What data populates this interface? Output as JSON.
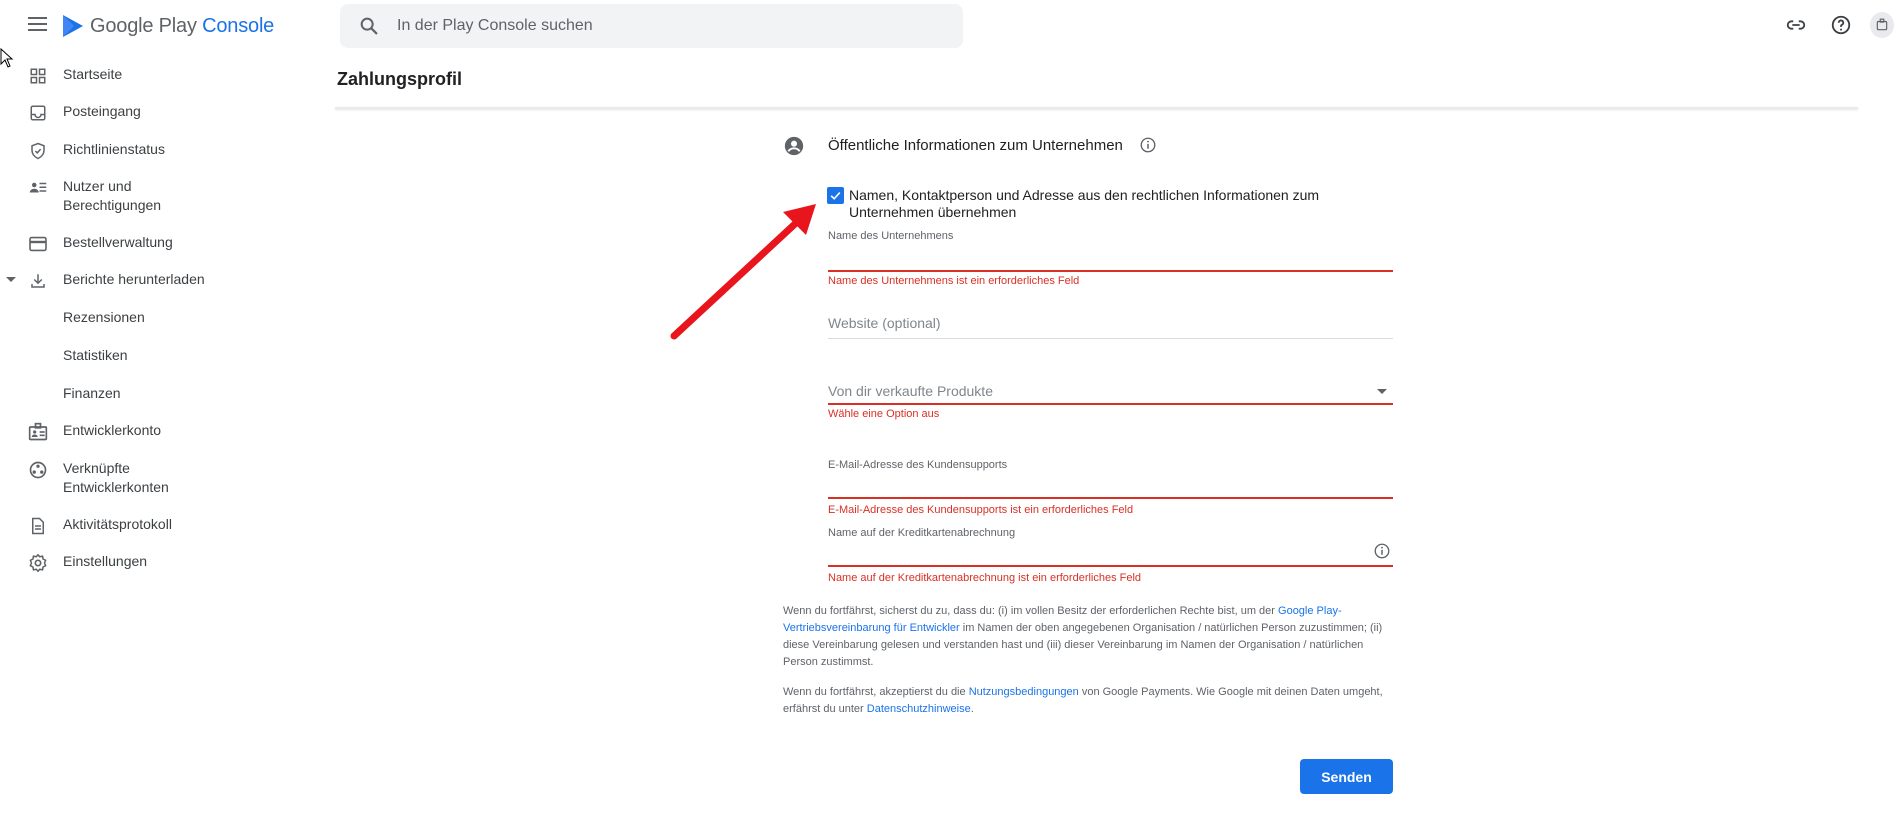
{
  "app": {
    "logo_text_1": "Google Play ",
    "logo_text_2": "Console",
    "search_placeholder": "In der Play Console suchen",
    "brand_color": "#1a73e8"
  },
  "sidebar": {
    "items": [
      {
        "label": "Startseite",
        "icon": "dashboard-icon"
      },
      {
        "label": "Posteingang",
        "icon": "inbox-icon"
      },
      {
        "label": "Richtlinienstatus",
        "icon": "shield-icon"
      },
      {
        "label": "Nutzer und Berechtigungen",
        "icon": "users-list-icon"
      },
      {
        "label": "Bestellverwaltung",
        "icon": "credit-card-icon"
      },
      {
        "label": "Berichte herunterladen",
        "icon": "download-icon",
        "expanded": true
      },
      {
        "label": "Rezensionen"
      },
      {
        "label": "Statistiken"
      },
      {
        "label": "Finanzen"
      },
      {
        "label": "Entwicklerkonto",
        "icon": "badge-icon"
      },
      {
        "label": "Verknüpfte Entwicklerkonten",
        "icon": "linked-accounts-icon"
      },
      {
        "label": "Aktivitätsprotokoll",
        "icon": "document-icon"
      },
      {
        "label": "Einstellungen",
        "icon": "gear-icon"
      }
    ]
  },
  "main": {
    "page_title": "Zahlungsprofil",
    "section_title": "Öffentliche Informationen zum Unternehmen",
    "checkbox_label": "Namen, Kontaktperson und Adresse aus den rechtlichen Informationen zum Unternehmen übernehmen",
    "checkbox_checked": true,
    "fields": {
      "company_name_label": "Name des Unternehmens",
      "company_name_error": "Name des Unternehmens ist ein erforderliches Feld",
      "website_placeholder": "Website (optional)",
      "products_placeholder": "Von dir verkaufte Produkte",
      "products_error": "Wähle eine Option aus",
      "support_email_label": "E-Mail-Adresse des Kundensupports",
      "support_email_error": "E-Mail-Adresse des Kundensupports ist ein erforderliches Feld",
      "statement_name_label": "Name auf der Kreditkartenabrechnung",
      "statement_name_error": "Name auf der Kreditkartenabrechnung ist ein erforderliches Feld"
    },
    "legal": {
      "p1_a": "Wenn du fortfährst, sicherst du zu, dass du: (i) im vollen Besitz der erforderlichen Rechte bist, um der ",
      "p1_link": "Google Play-Vertriebsvereinbarung für Entwickler",
      "p1_b": " im Namen der oben angegebenen Organisation / natürlichen Person zuzustimmen; (ii) diese Vereinbarung gelesen und verstanden hast und (iii) dieser Vereinbarung im Namen der Organisation / natürlichen Person zustimmst.",
      "p2_a": "Wenn du fortfährst, akzeptierst du die ",
      "p2_link1": "Nutzungsbedingungen",
      "p2_b": " von Google Payments. Wie Google mit deinen Daten umgeht, erfährst du unter ",
      "p2_link2": "Datenschutzhinweise",
      "p2_c": "."
    },
    "submit_label": "Senden",
    "error_color": "#d93025",
    "annotation_arrow_color": "#e8151c"
  }
}
